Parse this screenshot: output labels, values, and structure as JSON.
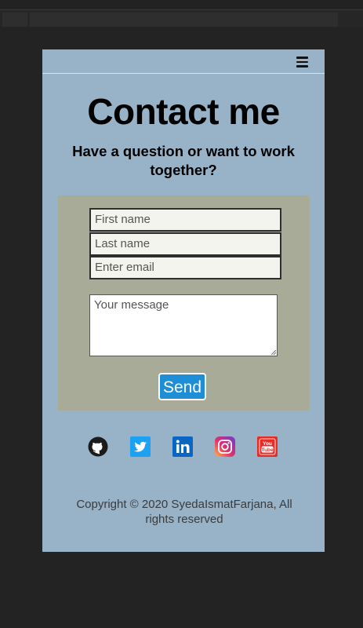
{
  "page": {
    "title": "Contact me",
    "subtitle": "Have a question or want to work together?"
  },
  "form": {
    "first_name_placeholder": "First name",
    "last_name_placeholder": "Last name",
    "email_placeholder": "Enter email",
    "message_placeholder": "Your message",
    "send_label": "Send"
  },
  "socials": [
    "github-icon",
    "twitter-icon",
    "linkedin-icon",
    "instagram-icon",
    "youtube-icon"
  ],
  "footer": {
    "copyright": "Copyright © 2020 SyedaIsmatFarjana, All rights reserved"
  },
  "colors": {
    "page_bg": "#98b2c7",
    "form_bg": "#a7ab98",
    "send_button": "#1e8ed6",
    "twitter": "#1da1f2",
    "linkedin": "#0a66c2",
    "youtube": "#e52d27"
  }
}
